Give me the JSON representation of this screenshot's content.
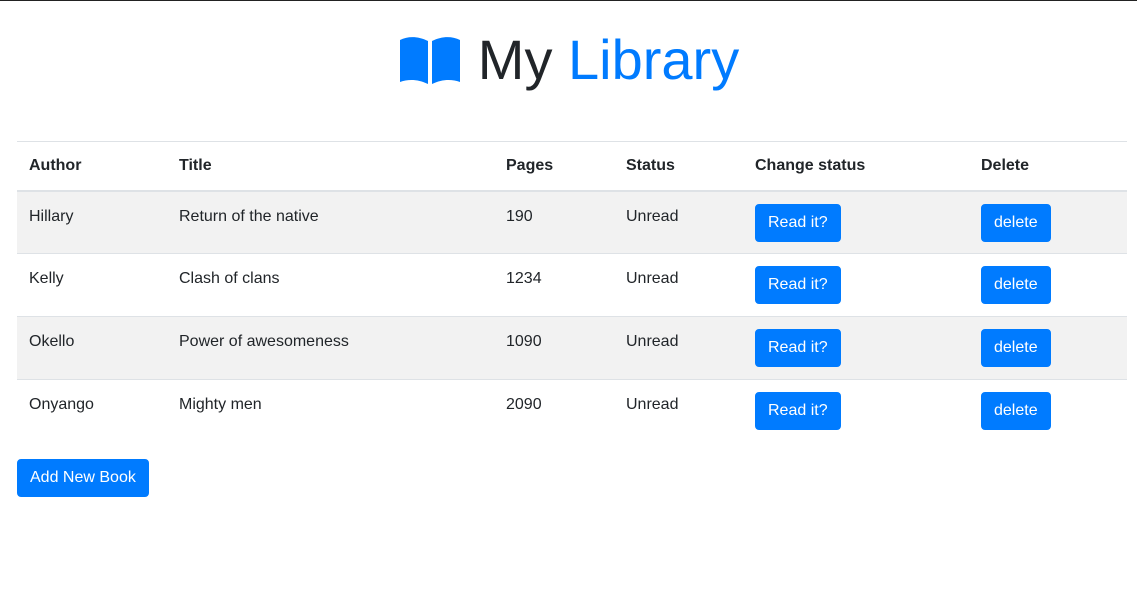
{
  "header": {
    "icon": "open-book-icon",
    "title_part1": "My",
    "title_part2": "Library",
    "accent_color": "#007bff"
  },
  "table": {
    "columns": [
      "Author",
      "Title",
      "Pages",
      "Status",
      "Change status",
      "Delete"
    ],
    "rows": [
      {
        "author": "Hillary",
        "title": "Return of the native",
        "pages": "190",
        "status": "Unread",
        "change_label": "Read it?",
        "delete_label": "delete"
      },
      {
        "author": "Kelly",
        "title": "Clash of clans",
        "pages": "1234",
        "status": "Unread",
        "change_label": "Read it?",
        "delete_label": "delete"
      },
      {
        "author": "Okello",
        "title": "Power of awesomeness",
        "pages": "1090",
        "status": "Unread",
        "change_label": "Read it?",
        "delete_label": "delete"
      },
      {
        "author": "Onyango",
        "title": "Mighty men",
        "pages": "2090",
        "status": "Unread",
        "change_label": "Read it?",
        "delete_label": "delete"
      }
    ]
  },
  "actions": {
    "add_label": "Add New Book"
  },
  "colors": {
    "button_bg": "#007bff",
    "stripe_bg": "#f2f2f2",
    "border": "#dee2e6"
  }
}
